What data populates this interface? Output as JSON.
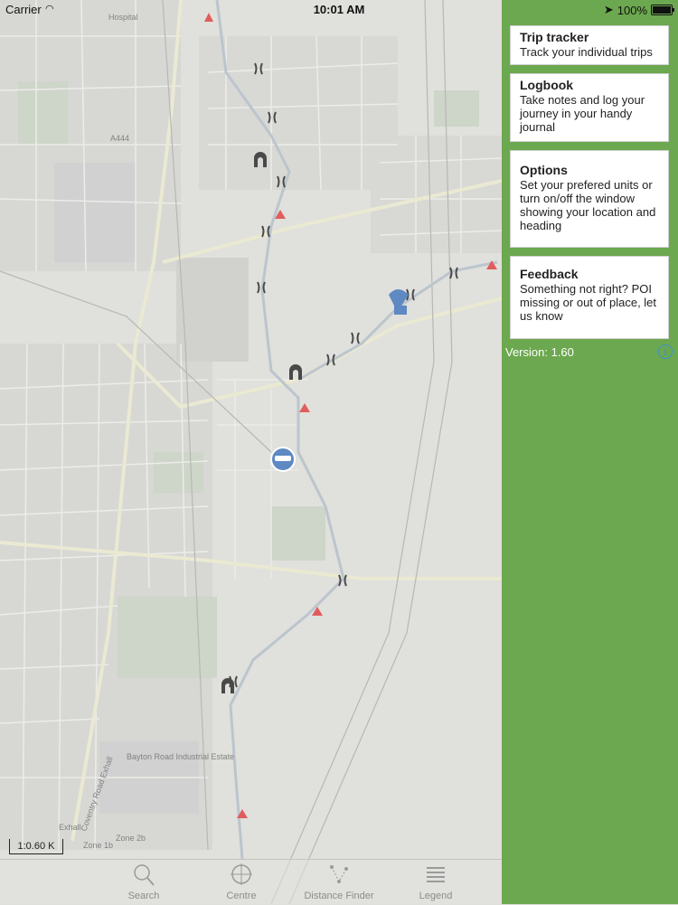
{
  "status_bar": {
    "carrier": "Carrier",
    "time": "10:01 AM",
    "battery": "100%"
  },
  "map": {
    "scale_label": "1:0.60 K",
    "place_labels": [
      "Bayton Road Industrial Estate",
      "Coventry Road Exhall",
      "Zone 2b",
      "Exhall",
      "Zone 1b",
      "A444",
      "Hospital"
    ]
  },
  "tabbar": {
    "tabs": [
      {
        "label": "Search",
        "icon": "search-icon"
      },
      {
        "label": "Centre",
        "icon": "centre-icon"
      },
      {
        "label": "Distance Finder",
        "icon": "distance-finder-icon"
      },
      {
        "label": "Legend",
        "icon": "legend-icon"
      }
    ]
  },
  "panel": {
    "background": "#6ca84f",
    "cards": [
      {
        "title": "Trip tracker",
        "description": "Track your individual trips"
      },
      {
        "title": "Logbook",
        "description": "Take notes and log your journey in your handy journal"
      },
      {
        "title": "Options",
        "description": "Set your prefered units or turn on/off the window showing your location and heading"
      },
      {
        "title": "Feedback",
        "description": "Something not right? POI missing or out of place, let us know"
      }
    ],
    "version": "Version: 1.60"
  }
}
